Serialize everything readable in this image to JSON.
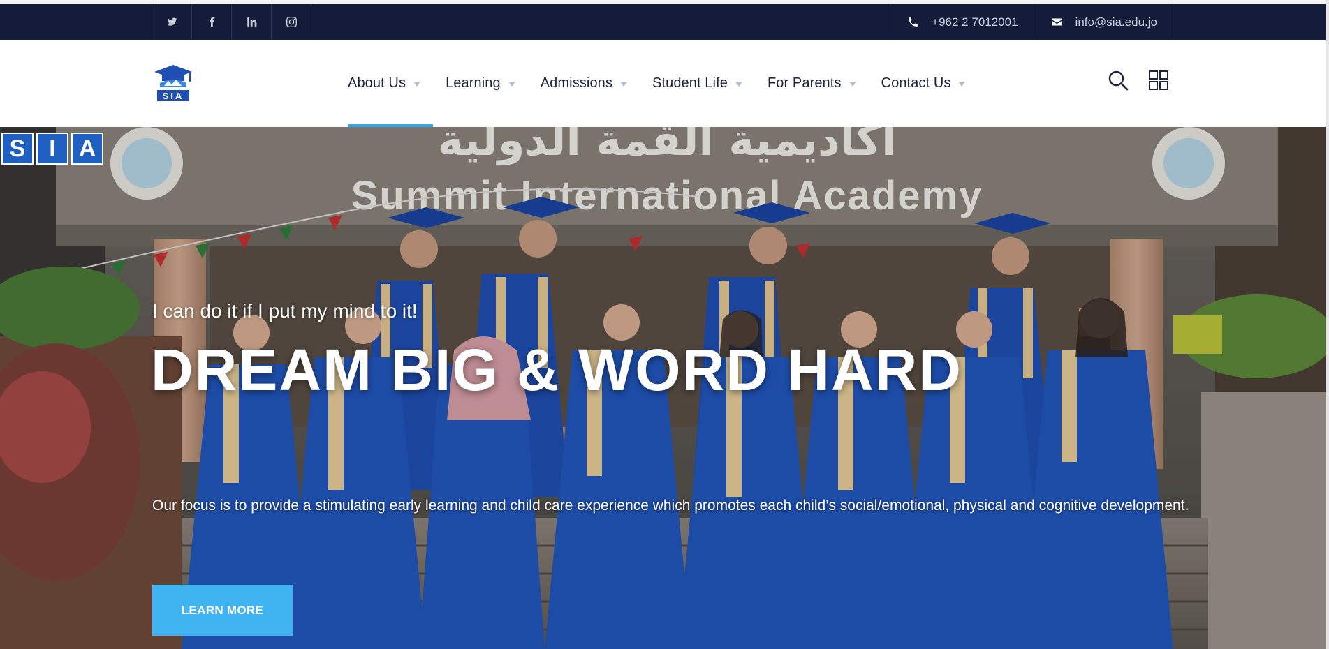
{
  "topbar": {
    "social": [
      {
        "icon": "twitter-icon"
      },
      {
        "icon": "facebook-icon"
      },
      {
        "icon": "linkedin-icon"
      },
      {
        "icon": "instagram-icon"
      }
    ],
    "phone": "+962 2 7012001",
    "email": "info@sia.edu.jo"
  },
  "header": {
    "logo_text": "SIA",
    "nav": [
      {
        "label": "About Us",
        "active": true
      },
      {
        "label": "Learning"
      },
      {
        "label": "Admissions"
      },
      {
        "label": "Student Life"
      },
      {
        "label": "For Parents"
      },
      {
        "label": "Contact Us"
      }
    ]
  },
  "hero": {
    "building_arabic": "أكاديمية القمة الدولية",
    "building_english": "Summit International Academy",
    "badge_letters": [
      "S",
      "I",
      "A"
    ],
    "tagline": "I can do it if I put my mind to it!",
    "headline": "DREAM BIG & WORD HARD",
    "description": "Our focus is to provide a stimulating early learning and child care experience which promotes each child’s social/emotional, physical and cognitive development.",
    "cta_label": "LEARN MORE"
  },
  "colors": {
    "topbar_bg": "#141c3a",
    "accent": "#3fb4f0",
    "nav_text": "#1c2340",
    "gown_blue": "#1f4fb3"
  }
}
